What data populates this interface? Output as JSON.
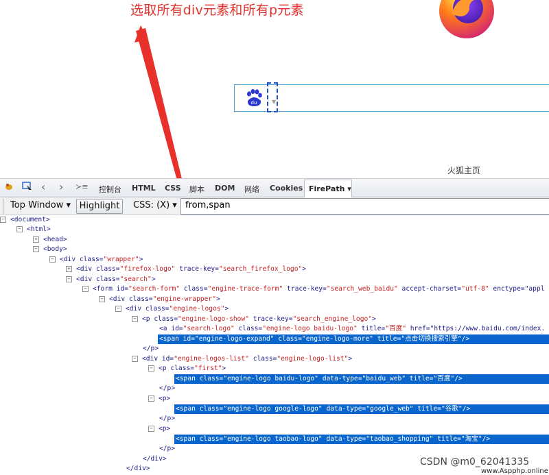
{
  "annotation": "选取所有div元素和所有p元素",
  "fox_link": "火狐主页",
  "devtools": {
    "tabs": [
      "控制台",
      "HTML",
      "CSS",
      "脚本",
      "DOM",
      "网络",
      "Cookies"
    ],
    "active_tab": "FirePath ▾",
    "top_window": "Top Window ▾",
    "highlight": "Highlight",
    "css_mode": "CSS: (X) ▾",
    "xpath_value": "from,span"
  },
  "tree": [
    {
      "t": "<document>"
    },
    {
      "t": "<html>"
    },
    {
      "t": "<head>"
    },
    {
      "t": "<body>"
    },
    {
      "t": "<div class=\"wrapper\">"
    },
    {
      "t": "<div class=\"firefox-logo\" trace-key=\"search_firefox_logo\">"
    },
    {
      "t": "<div class=\"search\">"
    },
    {
      "t": "<form id=\"search-form\" class=\"engine-trace-form\" trace-key=\"search_web_baidu\" accept-charset=\"utf-8\" enctype=\"appl"
    },
    {
      "t": "<div class=\"engine-wrapper\">"
    },
    {
      "t": "<div class=\"engine-logos\">"
    },
    {
      "t": "<p class=\"engine-logo-show\" trace-key=\"search_engine_logo\">"
    },
    {
      "t": "<a id=\"search-logo\" class=\"engine-logo baidu-logo\" title=\"百度\" href=\"https://www.baidu.com/index."
    },
    {
      "t": "<span id=\"engine-logo-expand\" class=\"engine-logo-more\" title=\"点击切换搜索引擎\"/>"
    },
    {
      "t": "</p>"
    },
    {
      "t": "<div id=\"engine-logos-list\" class=\"engine-logo-list\">"
    },
    {
      "t": "<p class=\"first\">"
    },
    {
      "t": "<span class=\"engine-logo baidu-logo\" data-type=\"baidu_web\" title=\"百度\"/>"
    },
    {
      "t": "</p>"
    },
    {
      "t": "<p>"
    },
    {
      "t": "<span class=\"engine-logo google-logo\" data-type=\"google_web\" title=\"谷歌\"/>"
    },
    {
      "t": "</p>"
    },
    {
      "t": "<p>"
    },
    {
      "t": "<span class=\"engine-logo taobao-logo\" data-type=\"taobao_shopping\" title=\"淘宝\"/>"
    },
    {
      "t": "</p>"
    },
    {
      "t": "</div>"
    },
    {
      "t": "</div>"
    }
  ],
  "watermark": "CSDN @m0_62041335",
  "watermark2": "www.Aspphp.online",
  "colors": {
    "annotation": "#e0312c",
    "highlight": "#0a66cc",
    "attr_value": "#c71e1e",
    "tag": "#1b1b8a"
  }
}
